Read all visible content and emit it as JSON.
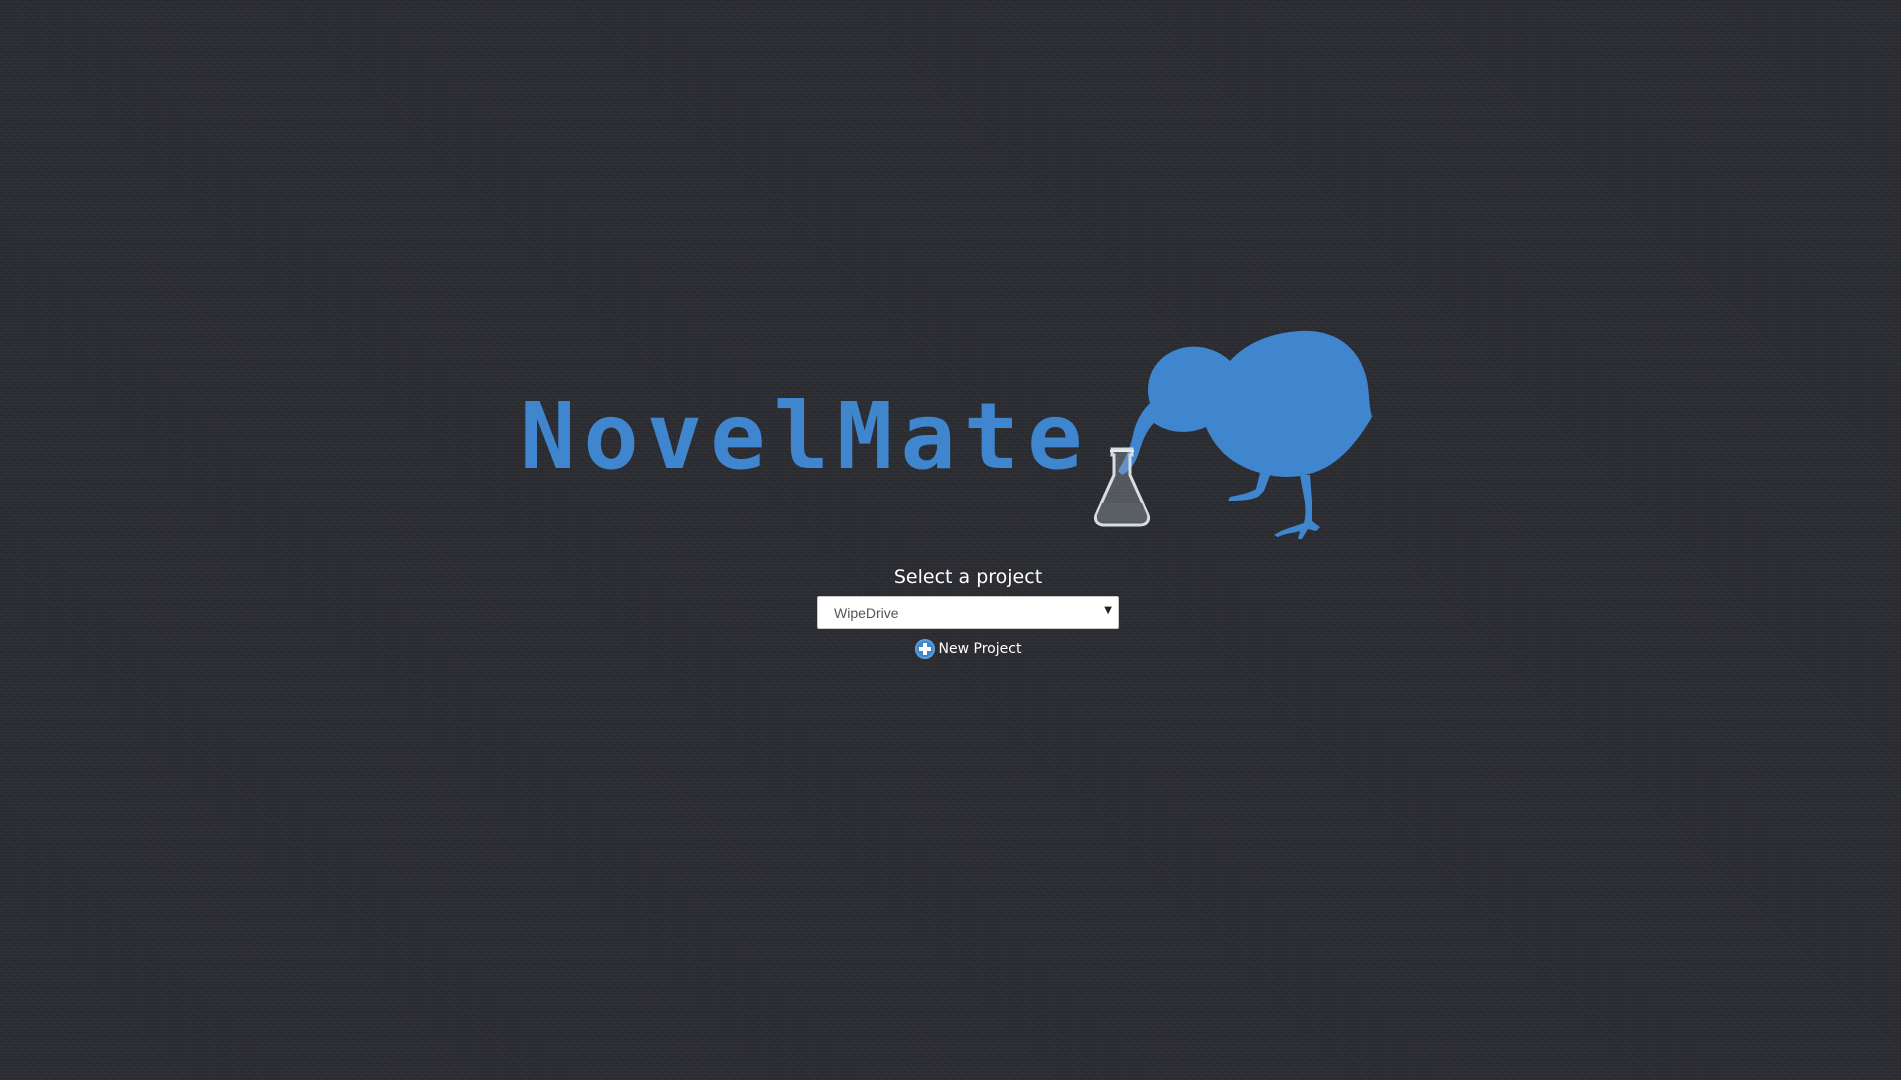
{
  "logo": {
    "text": "NovelMate",
    "accent_color": "#3f86cf",
    "icons": [
      "kiwi-bird-icon",
      "flask-icon"
    ]
  },
  "project_selector": {
    "heading": "Select a project",
    "selected_value": "WipeDrive",
    "arrow_glyph": "▼",
    "new_project_label": "New Project",
    "new_project_icon": "plus-circle-icon"
  },
  "colors": {
    "background": "#2b2c31",
    "text": "#ffffff",
    "accent": "#3f86cf"
  }
}
